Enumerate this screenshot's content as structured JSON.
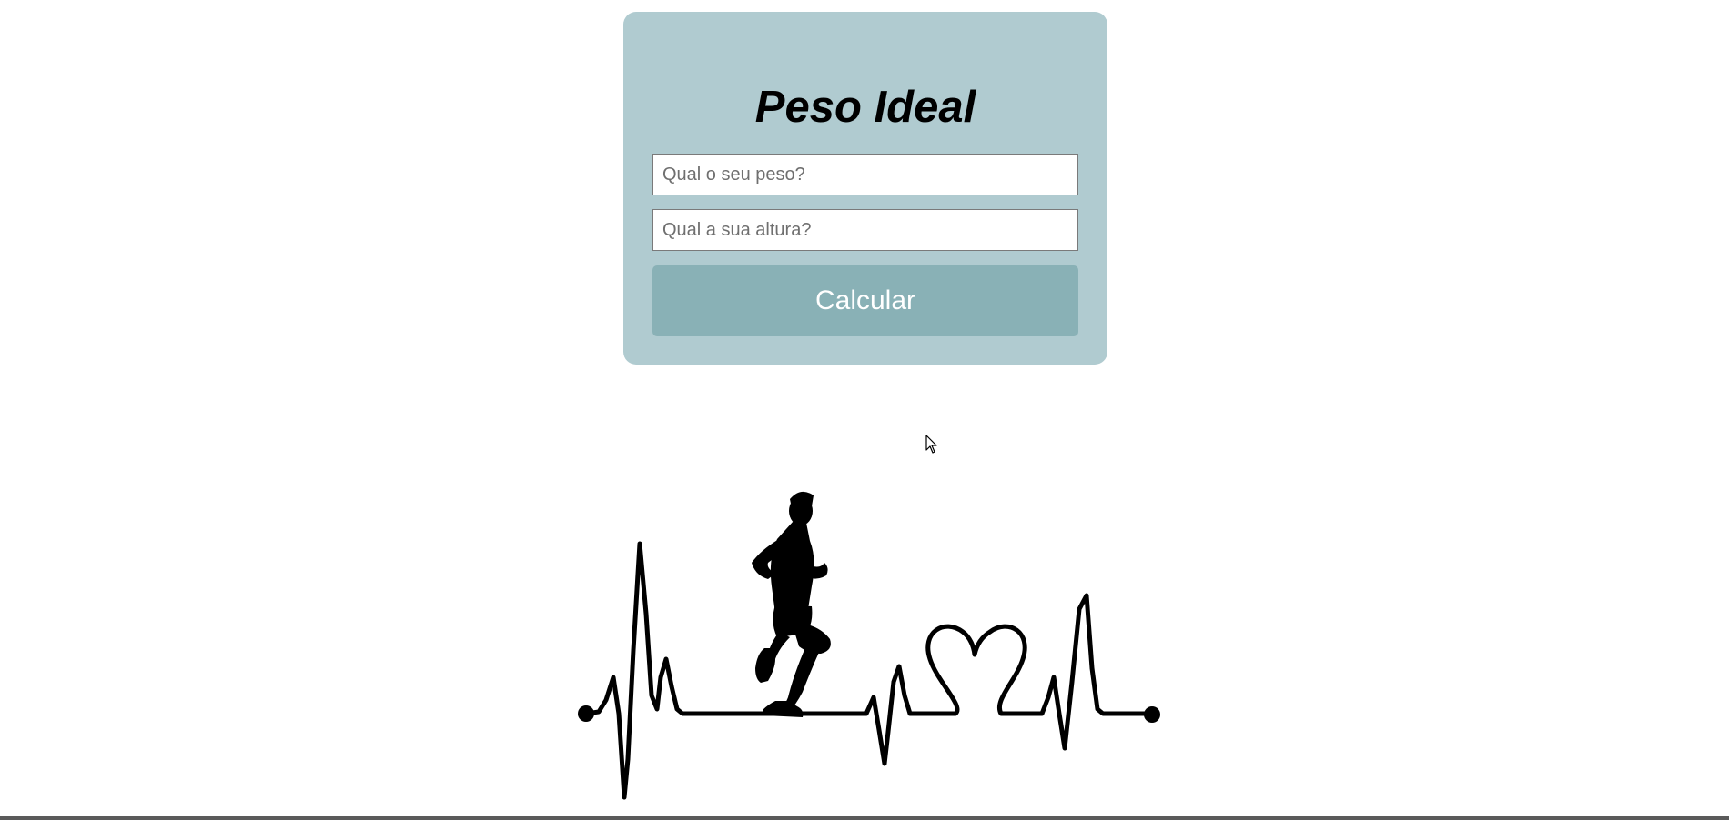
{
  "form": {
    "title": "Peso Ideal",
    "weight_placeholder": "Qual o seu peso?",
    "height_placeholder": "Qual a sua altura?",
    "submit_label": "Calcular"
  },
  "illustration": {
    "icon": "runner-heartbeat-icon"
  },
  "colors": {
    "card_background": "#b0cbd0",
    "button_background": "#89b1b6",
    "button_text": "#ffffff",
    "page_background": "#ffffff"
  }
}
